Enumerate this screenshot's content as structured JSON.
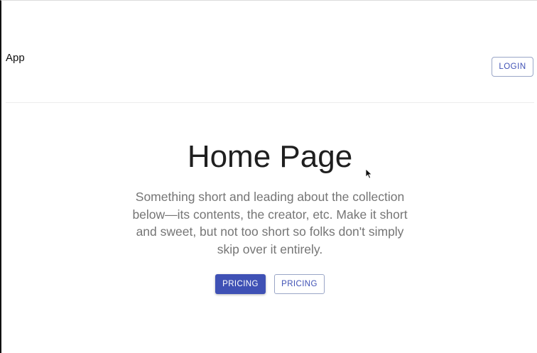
{
  "header": {
    "app_title": "App",
    "login_label": "LOGIN"
  },
  "hero": {
    "title": "Home Page",
    "description": "Something short and leading about the collection below—its contents, the creator, etc. Make it short and sweet, but not too short so folks don't simply skip over it entirely.",
    "primary_button_label": "PRICING",
    "secondary_button_label": "PRICING"
  },
  "colors": {
    "accent": "#3f51b5",
    "text_muted": "#757575",
    "title": "#1f1f1f"
  },
  "icons": {
    "cursor": "mouse-pointer-icon"
  }
}
